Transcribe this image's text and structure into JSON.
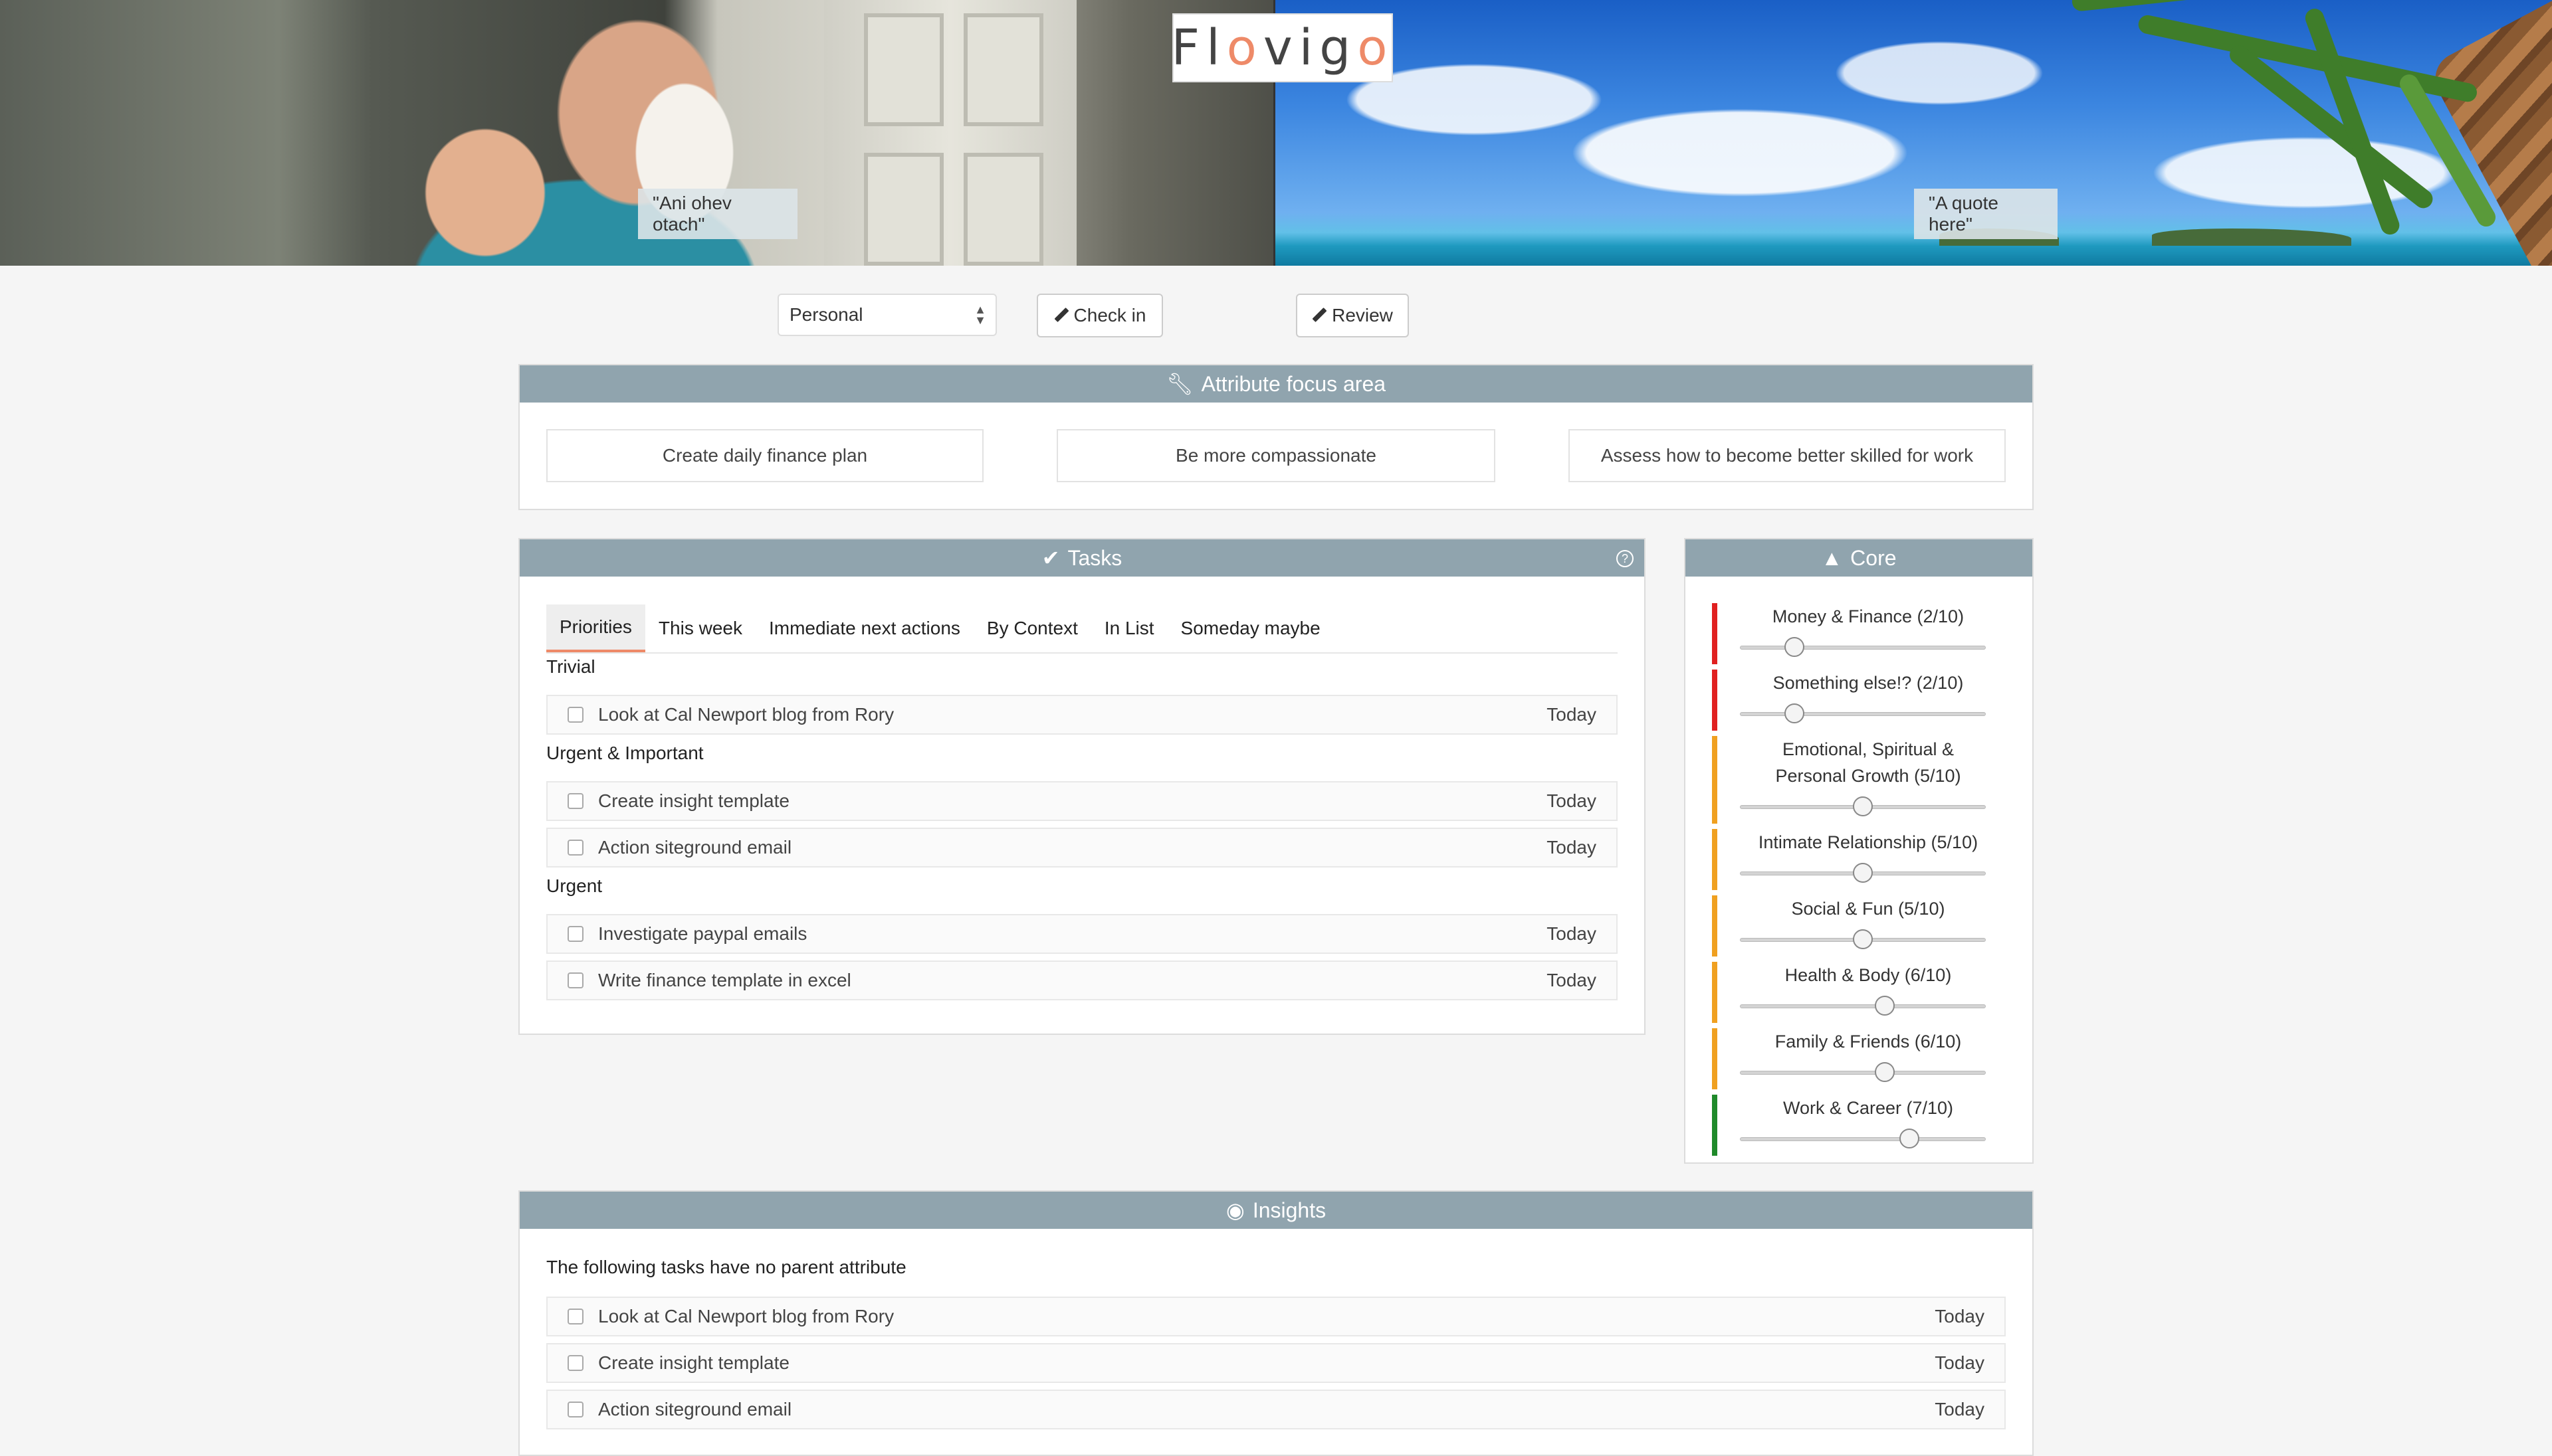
{
  "header": {
    "logo": {
      "prefix": "Fl",
      "o1": "o",
      "mid": "vig",
      "o2": "o"
    },
    "quote_left": "\"Ani ohev otach\"",
    "quote_right": "\"A quote here\""
  },
  "toolbar": {
    "selected_area": "Personal",
    "checkin_label": "Check in",
    "review_label": "Review"
  },
  "attribute_focus": {
    "title": "Attribute focus area",
    "items": [
      "Create daily finance plan",
      "Be more compassionate",
      "Assess how to become better skilled for work"
    ]
  },
  "tasks": {
    "title": "Tasks",
    "tabs": [
      "Priorities",
      "This week",
      "Immediate next actions",
      "By Context",
      "In List",
      "Someday maybe"
    ],
    "active_tab": "Priorities",
    "groups": [
      {
        "label": "Trivial",
        "items": [
          {
            "text": "Look at Cal Newport blog from Rory",
            "date": "Today"
          }
        ]
      },
      {
        "label": "Urgent & Important",
        "items": [
          {
            "text": "Create insight template",
            "date": "Today"
          },
          {
            "text": "Action siteground email",
            "date": "Today"
          }
        ]
      },
      {
        "label": "Urgent",
        "items": [
          {
            "text": "Investigate paypal emails",
            "date": "Today"
          },
          {
            "text": "Write finance template in excel",
            "date": "Today"
          }
        ]
      }
    ]
  },
  "core": {
    "title": "Core",
    "items": [
      {
        "label": "Money & Finance (2/10)",
        "value": 2,
        "status_color": "#e02020"
      },
      {
        "label": "Something else!? (2/10)",
        "value": 2,
        "status_color": "#e02020"
      },
      {
        "label": "Emotional, Spiritual & Personal Growth (5/10)",
        "value": 5,
        "status_color": "#f0a020"
      },
      {
        "label": "Intimate Relationship (5/10)",
        "value": 5,
        "status_color": "#f0a020"
      },
      {
        "label": "Social & Fun (5/10)",
        "value": 5,
        "status_color": "#f0a020"
      },
      {
        "label": "Health & Body (6/10)",
        "value": 6,
        "status_color": "#f0a020"
      },
      {
        "label": "Family & Friends (6/10)",
        "value": 6,
        "status_color": "#f0a020"
      },
      {
        "label": "Work & Career (7/10)",
        "value": 7,
        "status_color": "#1f8a2a"
      }
    ]
  },
  "insights": {
    "title": "Insights",
    "subtitle": "The following tasks have no parent attribute",
    "items": [
      {
        "text": "Look at Cal Newport blog from Rory",
        "date": "Today"
      },
      {
        "text": "Create insight template",
        "date": "Today"
      },
      {
        "text": "Action siteground email",
        "date": "Today"
      }
    ]
  },
  "colors": {
    "panel_header": "#90a4ae",
    "accent": "#ee8a68"
  }
}
